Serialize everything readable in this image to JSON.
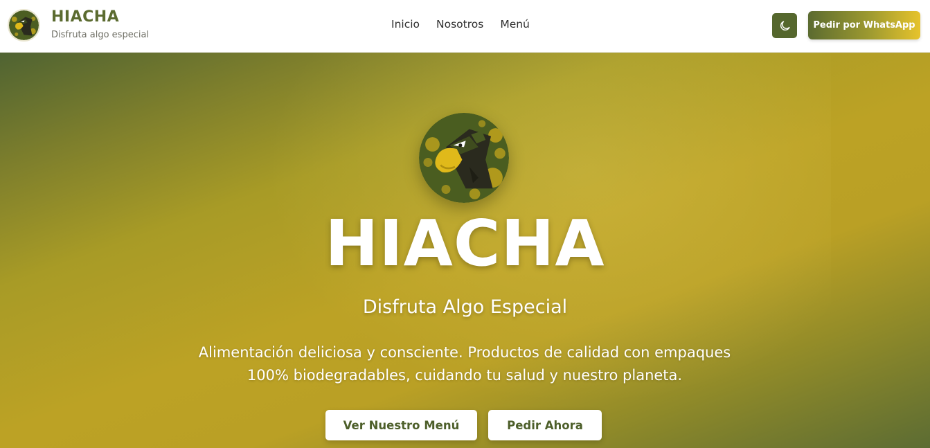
{
  "header": {
    "brand_name": "HIACHA",
    "brand_tagline": "Disfruta algo especial",
    "nav": [
      {
        "label": "Inicio"
      },
      {
        "label": "Nosotros"
      },
      {
        "label": "Menú"
      }
    ],
    "theme_toggle_icon": "moon-icon",
    "whatsapp_label": "Pedir por WhatsApp"
  },
  "hero": {
    "title": "HIACHA",
    "subtitle": "Disfruta Algo Especial",
    "description": "Alimentación deliciosa y consciente. Productos de calidad con empaques 100% biodegradables, cuidando tu salud y nuestro planeta.",
    "buttons": {
      "menu_label": "Ver Nuestro Menú",
      "order_label": "Pedir Ahora"
    }
  },
  "colors": {
    "brand_green": "#55672d",
    "brand_gold": "#e6c32c",
    "hero_gradient_mid": "#bca225"
  }
}
